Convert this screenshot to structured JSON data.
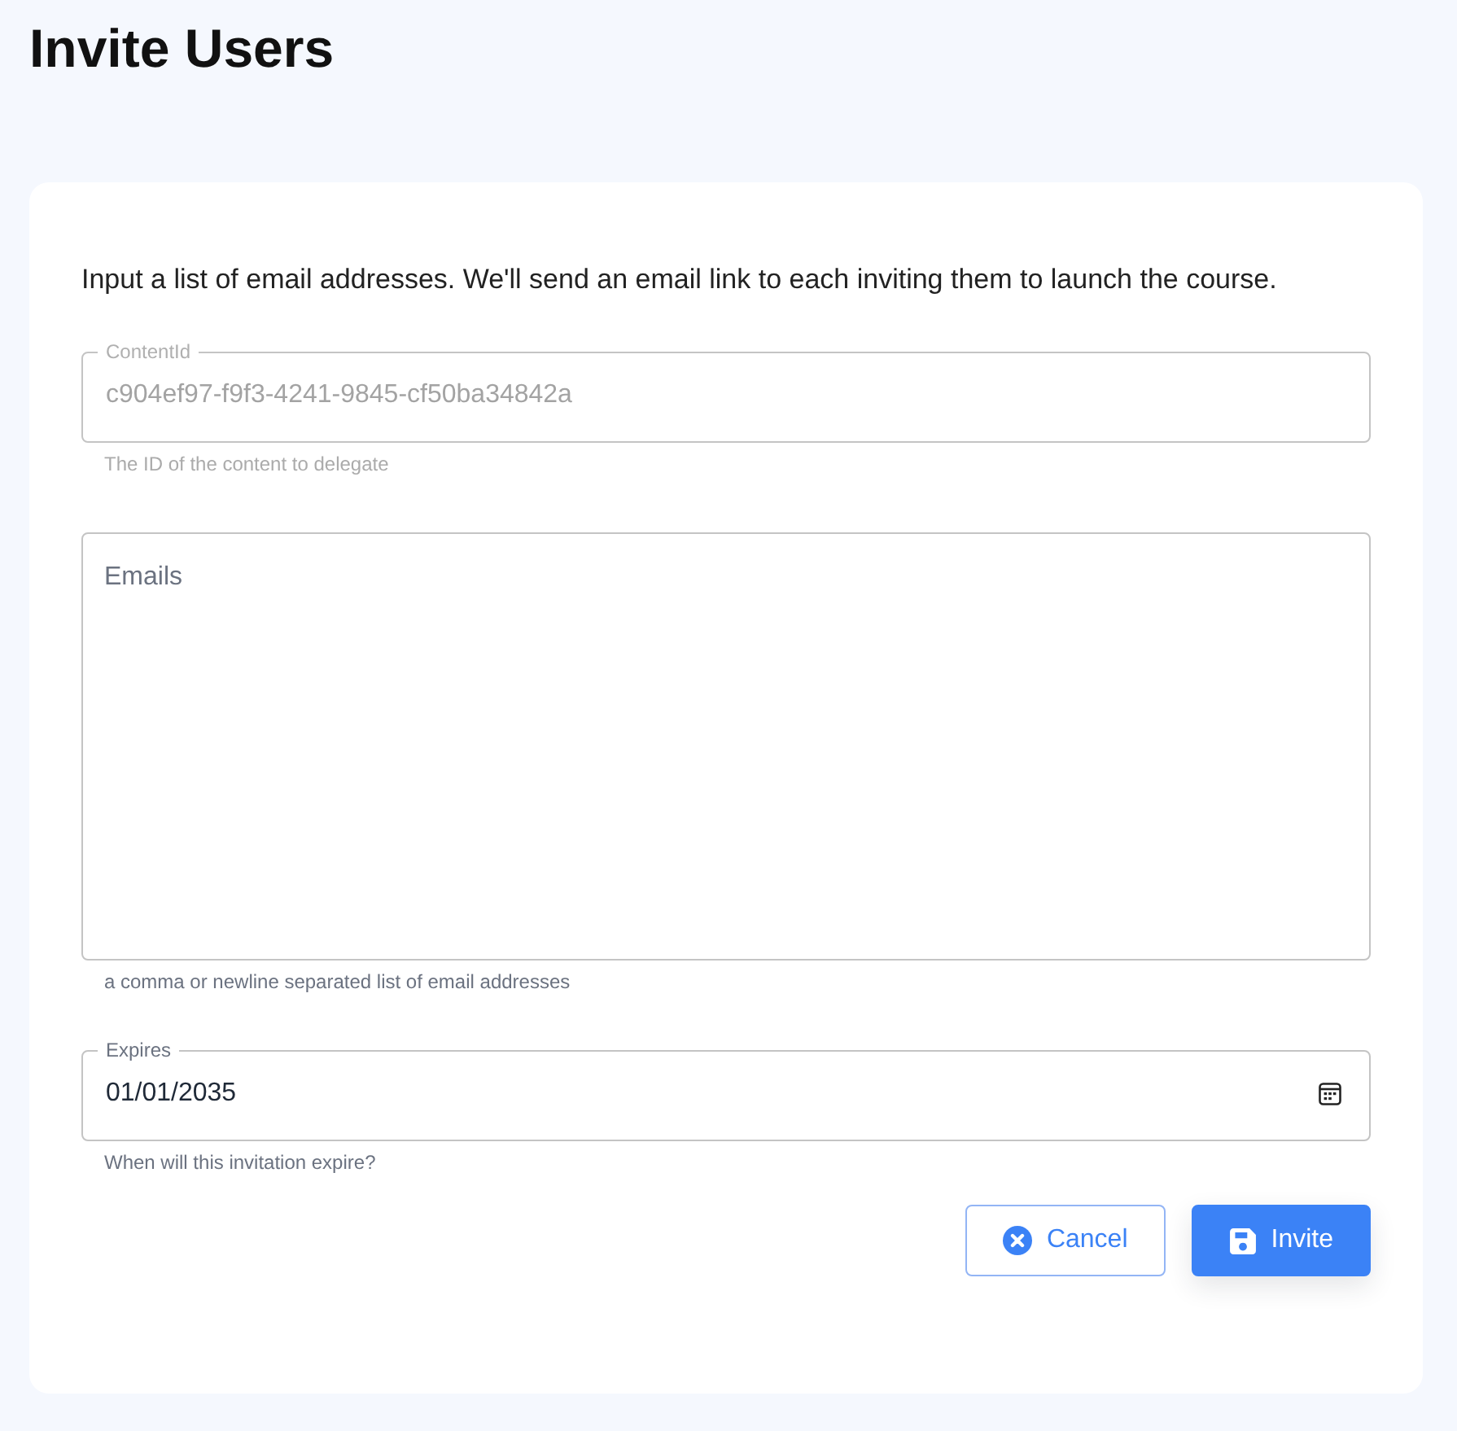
{
  "page": {
    "title": "Invite Users"
  },
  "form": {
    "intro": "Input a list of email addresses. We'll send an email link to each inviting them to launch the course.",
    "fields": [
      {
        "kind": "text",
        "label": "ContentId",
        "value": "c904ef97-f9f3-4241-9845-cf50ba34842a",
        "helper": "The ID of the content to delegate",
        "disabled": true
      },
      {
        "kind": "textarea",
        "placeholder": "Emails",
        "helper": "a comma or newline separated list of email addresses",
        "disabled": false
      },
      {
        "kind": "date",
        "label": "Expires",
        "value": "01/01/2035",
        "helper": "When will this invitation expire?",
        "disabled": false
      }
    ],
    "buttons": [
      {
        "kind": "cancel",
        "label": "Cancel"
      },
      {
        "kind": "submit",
        "label": "Invite"
      }
    ]
  }
}
